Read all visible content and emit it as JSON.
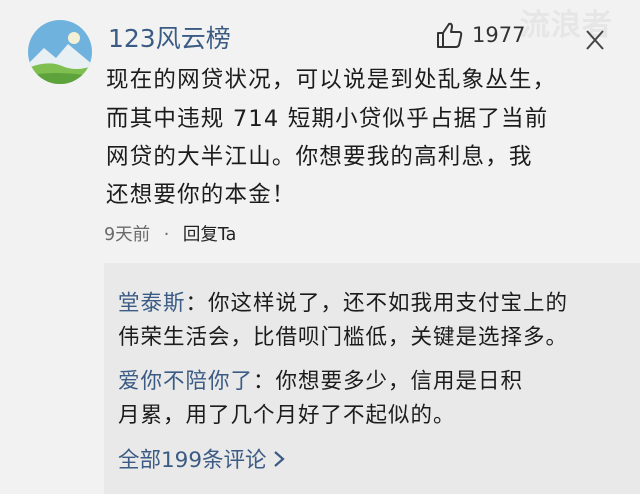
{
  "watermark": "流浪者",
  "comment": {
    "username": "123风云榜",
    "like_count": "1977",
    "lines": [
      "现在的网贷状况，可以说是到处乱象丛生，",
      "而其中违规 714 短期小贷似乎占据了当前",
      "网贷的大半江山。你想要我的高利息，我",
      "还想要你的本金！"
    ],
    "time": "9天前",
    "separator": "·",
    "reply_label": "回复Ta"
  },
  "replies": [
    {
      "username": "堂泰斯",
      "colon": "：",
      "line1": "你这样说了，还不如我用支付宝上的",
      "line2": "伟荣生活会，比借呗门槛低，关键是选择多。"
    },
    {
      "username": "爱你不陪你了",
      "colon": "：",
      "line1": "你想要多少，信用是日积",
      "line2": "月累，用了几个月好了不起似的。"
    }
  ],
  "view_all": {
    "label": "全部199条评论",
    "icon": "chevron-right-icon"
  },
  "colors": {
    "link_blue": "#3b5b84",
    "background": "#f2f2f2",
    "reply_box": "#e9e9e9"
  }
}
